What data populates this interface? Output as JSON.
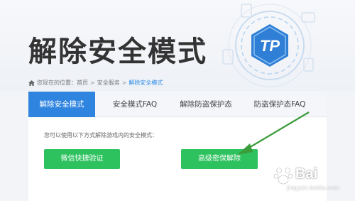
{
  "hero": {
    "title": "解除安全模式"
  },
  "logo": {
    "text": "TP"
  },
  "breadcrumb": {
    "prefix": "您现在的位置：",
    "items": [
      "首页",
      "安全服务",
      "解除安全模式"
    ],
    "separator": ">"
  },
  "tabs": [
    {
      "label": "解除安全模式",
      "active": true
    },
    {
      "label": "安全模式FAQ",
      "active": false
    },
    {
      "label": "解除防盗保护态",
      "active": false
    },
    {
      "label": "防盗保护态FAQ",
      "active": false
    }
  ],
  "content": {
    "hint": "您可以使用以下方式解除游戏内的安全模式：",
    "buttons": {
      "wechat": "微信快捷验证",
      "advanced": "高级密保解除"
    }
  },
  "watermark": {
    "text": "Bai",
    "sub": "jingyan.baidu.com"
  },
  "colors": {
    "accent_blue": "#2f84e0",
    "button_green": "#2ec25f",
    "arrow_green": "#3a9c3a"
  }
}
